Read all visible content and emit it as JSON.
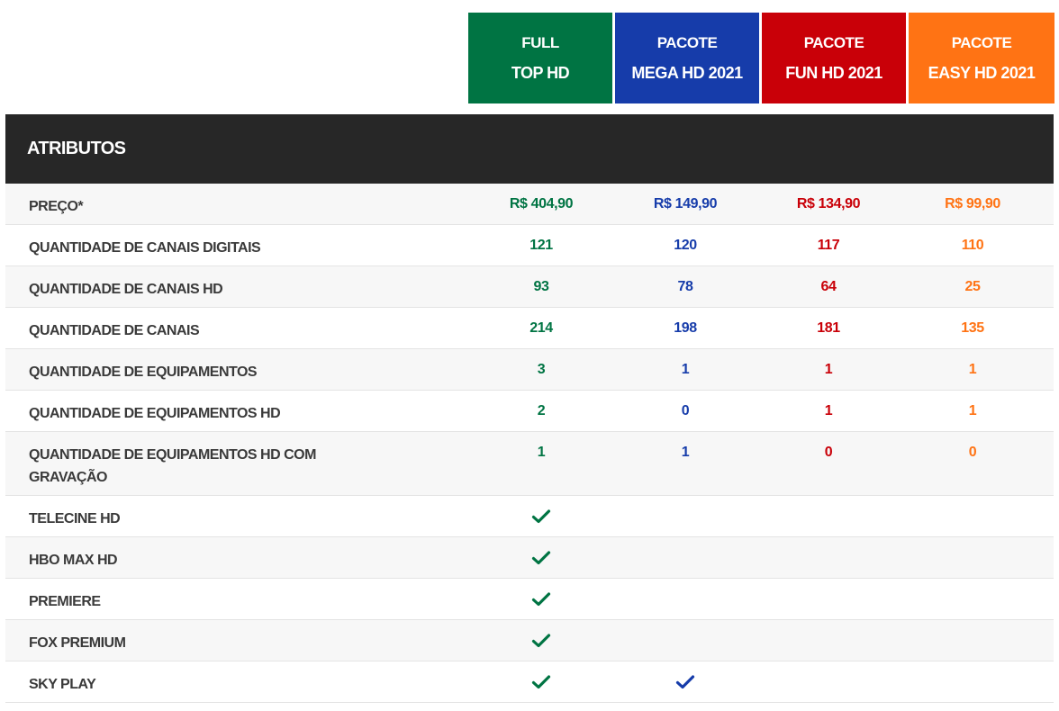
{
  "colors": {
    "green": "#007443",
    "blue": "#163caa",
    "red": "#c90008",
    "orange": "#ff7314",
    "dark": "#272727"
  },
  "plans": [
    {
      "line1": "FULL",
      "line2": "TOP HD",
      "color": "#007443"
    },
    {
      "line1": "PACOTE",
      "line2": "MEGA HD 2021",
      "color": "#163caa"
    },
    {
      "line1": "PACOTE",
      "line2": "FUN HD 2021",
      "color": "#c90008"
    },
    {
      "line1": "PACOTE",
      "line2": "EASY HD 2021",
      "color": "#ff7314"
    }
  ],
  "table": {
    "header": "ATRIBUTOS",
    "rows": [
      {
        "label": "PREÇO*",
        "values": [
          "R$ 404,90",
          "R$ 149,90",
          "R$ 134,90",
          "R$ 99,90"
        ]
      },
      {
        "label": "QUANTIDADE DE CANAIS DIGITAIS",
        "values": [
          "121",
          "120",
          "117",
          "110"
        ]
      },
      {
        "label": "QUANTIDADE DE CANAIS HD",
        "values": [
          "93",
          "78",
          "64",
          "25"
        ]
      },
      {
        "label": "QUANTIDADE DE CANAIS",
        "values": [
          "214",
          "198",
          "181",
          "135"
        ]
      },
      {
        "label": "QUANTIDADE DE EQUIPAMENTOS",
        "values": [
          "3",
          "1",
          "1",
          "1"
        ]
      },
      {
        "label": "QUANTIDADE DE EQUIPAMENTOS HD",
        "values": [
          "2",
          "0",
          "1",
          "1"
        ]
      },
      {
        "label": "QUANTIDADE DE EQUIPAMENTOS HD COM GRAVAÇÃO",
        "values": [
          "1",
          "1",
          "0",
          "0"
        ]
      },
      {
        "label": "TELECINE HD",
        "checks": [
          true,
          false,
          false,
          false
        ]
      },
      {
        "label": "HBO MAX HD",
        "checks": [
          true,
          false,
          false,
          false
        ]
      },
      {
        "label": "PREMIERE",
        "checks": [
          true,
          false,
          false,
          false
        ]
      },
      {
        "label": "FOX PREMIUM",
        "checks": [
          true,
          false,
          false,
          false
        ]
      },
      {
        "label": "SKY PLAY",
        "checks": [
          true,
          true,
          false,
          false
        ]
      }
    ]
  },
  "icons": {
    "check": "check-icon"
  }
}
